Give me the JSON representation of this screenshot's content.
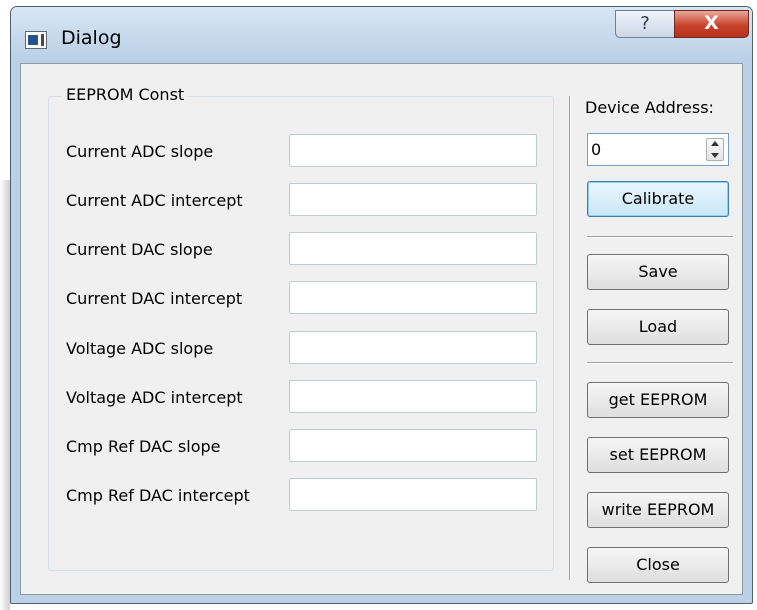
{
  "window": {
    "title": "Dialog",
    "help_label": "?",
    "close_label": "X"
  },
  "group": {
    "title": "EEPROM Const",
    "fields": [
      {
        "label": "Current ADC slope",
        "value": ""
      },
      {
        "label": "Current ADC intercept",
        "value": ""
      },
      {
        "label": "Current DAC slope",
        "value": ""
      },
      {
        "label": "Current DAC intercept",
        "value": ""
      },
      {
        "label": "Voltage ADC slope",
        "value": ""
      },
      {
        "label": "Voltage ADC intercept",
        "value": ""
      },
      {
        "label": "Cmp Ref DAC slope",
        "value": ""
      },
      {
        "label": "Cmp Ref DAC intercept",
        "value": ""
      }
    ]
  },
  "side": {
    "device_address_label": "Device Address:",
    "device_address_value": "0",
    "buttons": {
      "calibrate": "Calibrate",
      "save": "Save",
      "load": "Load",
      "get_eeprom": "get EEPROM",
      "set_eeprom": "set EEPROM",
      "write_eeprom": "write EEPROM",
      "close": "Close"
    }
  }
}
